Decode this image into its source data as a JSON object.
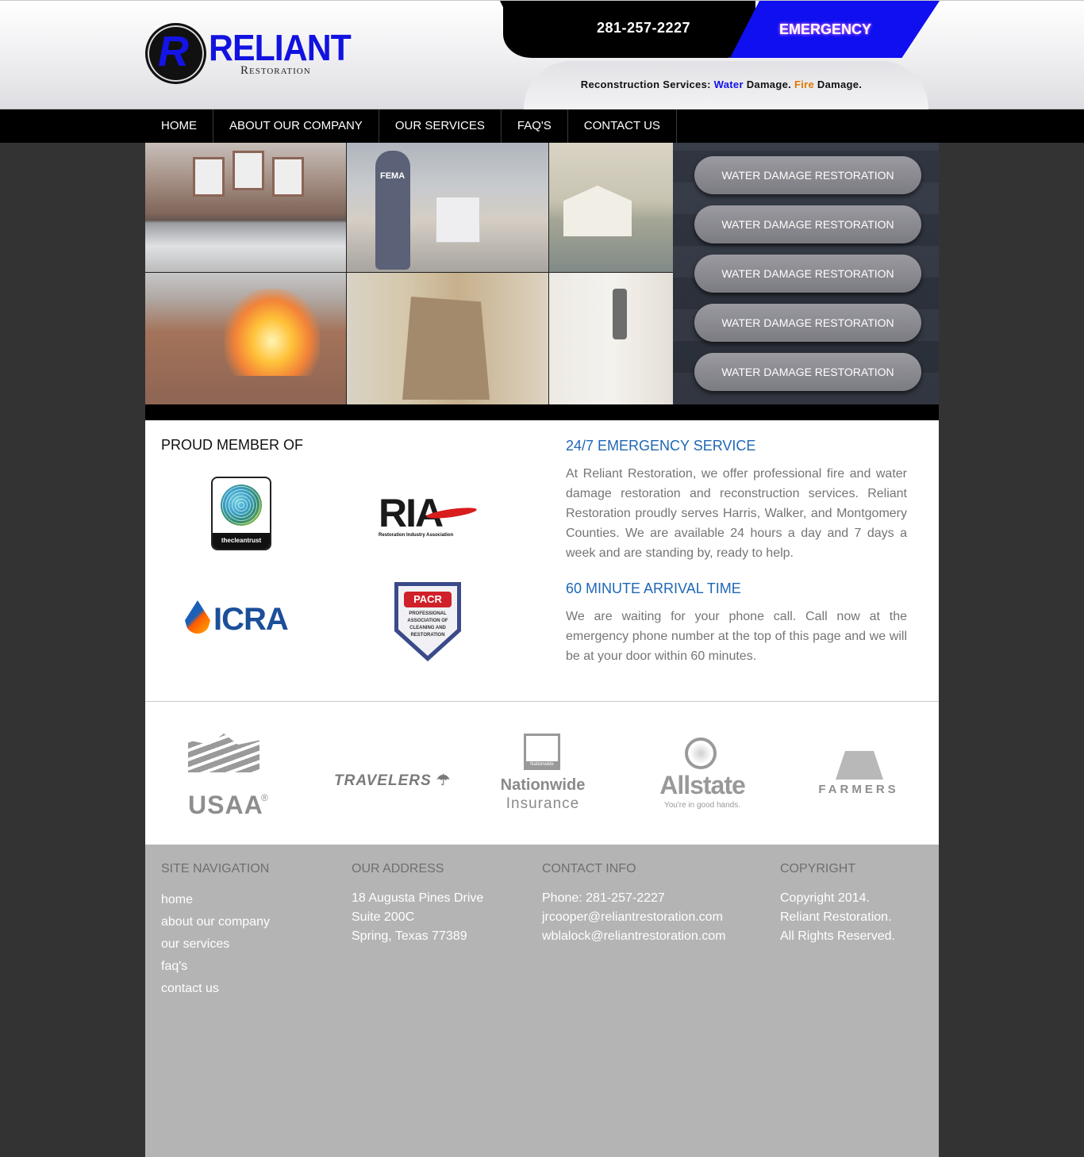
{
  "header": {
    "logo_letter": "R",
    "logo_name": "Reliant",
    "logo_sub": "Restoration",
    "phone": "281-257-2227",
    "emergency": "EMERGENCY",
    "tagline_prefix": "Reconstruction Services:",
    "tagline_water": "Water",
    "tagline_mid": "Damage.",
    "tagline_fire": "Fire",
    "tagline_end": "Damage."
  },
  "nav": [
    "HOME",
    "ABOUT OUR COMPANY",
    "OUR SERVICES",
    "FAQ'S",
    "CONTACT US"
  ],
  "hero": {
    "services": [
      "WATER DAMAGE RESTORATION",
      "WATER DAMAGE RESTORATION",
      "WATER DAMAGE RESTORATION",
      "WATER DAMAGE RESTORATION",
      "WATER DAMAGE RESTORATION"
    ],
    "photo2_text": "FEMA"
  },
  "members": {
    "title": "PROUD MEMBER OF",
    "cleantrust": "thecleantrust",
    "ria": "RIA",
    "ria_caption": "Restoration Industry Association",
    "icra": "ICRA",
    "pacr": "PACR",
    "pacr_lines": "PROFESSIONAL ASSOCIATION OF CLEANING AND RESTORATION"
  },
  "emergency_section": {
    "title": "24/7 EMERGENCY SERVICE",
    "text": "At Reliant Restoration, we offer professional fire and water damage restoration and reconstruction services. Reliant Restoration proudly serves Harris, Walker, and Montgomery Counties. We are available 24 hours a day and 7 days a week and are standing by, ready to help."
  },
  "arrival_section": {
    "title": "60 MINUTE ARRIVAL TIME",
    "text": "We are waiting for your phone call. Call now at the emergency phone number at the top of this page and we will be at your door within 60 minutes."
  },
  "insurers": {
    "usaa": "USAA",
    "usaa_reg": "®",
    "travelers": "TRAVELERS",
    "nationwide_1": "Nationwide",
    "nationwide_2": "Insurance",
    "allstate_1": "Allstate",
    "allstate_2": "You're in good hands.",
    "farmers": "FARMERS"
  },
  "footer": {
    "nav_title": "SITE NAVIGATION",
    "nav_links": [
      "home",
      "about our company",
      "our services",
      "faq's",
      "contact us"
    ],
    "address_title": "OUR ADDRESS",
    "address_lines": [
      "18 Augusta Pines Drive",
      "Suite 200C",
      "Spring, Texas 77389"
    ],
    "contact_title": "CONTACT INFO",
    "contact_lines": [
      "Phone: 281-257-2227",
      "jrcooper@reliantrestoration.com",
      "wblalock@reliantrestoration.com"
    ],
    "copyright_title": "COPYRIGHT",
    "copyright_lines": [
      "Copyright 2014.",
      "Reliant Restoration.",
      "All Rights Reserved."
    ]
  },
  "colors": {
    "brand_blue": "#1212e0",
    "emergency_blue": "#0f0ff0",
    "fire_orange": "#e07800",
    "heading_blue": "#1f67b5",
    "footer_bg": "#b4b4b4",
    "page_bg": "#333333"
  }
}
